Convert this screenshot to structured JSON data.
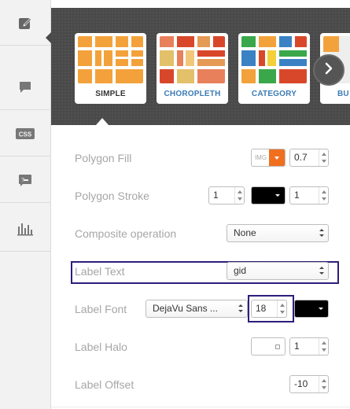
{
  "sidebar": {
    "items": [
      {
        "icon": "pencil-edit-icon"
      },
      {
        "icon": "speech-bubble-icon"
      },
      {
        "icon": "css-icon",
        "label": "CSS"
      },
      {
        "icon": "sql-console-icon"
      },
      {
        "icon": "bar-chart-icon"
      }
    ]
  },
  "wizards": {
    "items": [
      {
        "label": "SIMPLE",
        "selected": true
      },
      {
        "label": "CHOROPLETH"
      },
      {
        "label": "CATEGORY"
      },
      {
        "label": "BU"
      }
    ],
    "next_icon": "chevron-right-icon"
  },
  "form": {
    "polygon_fill": {
      "label": "Polygon Fill",
      "img_label": "IMG",
      "opacity": "0.7",
      "accent": "#f06f1f"
    },
    "polygon_stroke": {
      "label": "Polygon Stroke",
      "width": "1",
      "color": "#000000",
      "opacity": "1"
    },
    "composite": {
      "label": "Composite operation",
      "value": "None"
    },
    "label_text": {
      "label": "Label Text",
      "value": "gid"
    },
    "label_font": {
      "label": "Label Font",
      "font": "DejaVu Sans ...",
      "size": "18",
      "color": "#000000"
    },
    "label_halo": {
      "label": "Label Halo",
      "width": "1"
    },
    "label_offset": {
      "label": "Label Offset",
      "value": "-10"
    }
  },
  "colors": {
    "highlight": "#2b1f7a",
    "link_blue": "#3c7bb4",
    "dark_strip": "#4a4a4a"
  }
}
